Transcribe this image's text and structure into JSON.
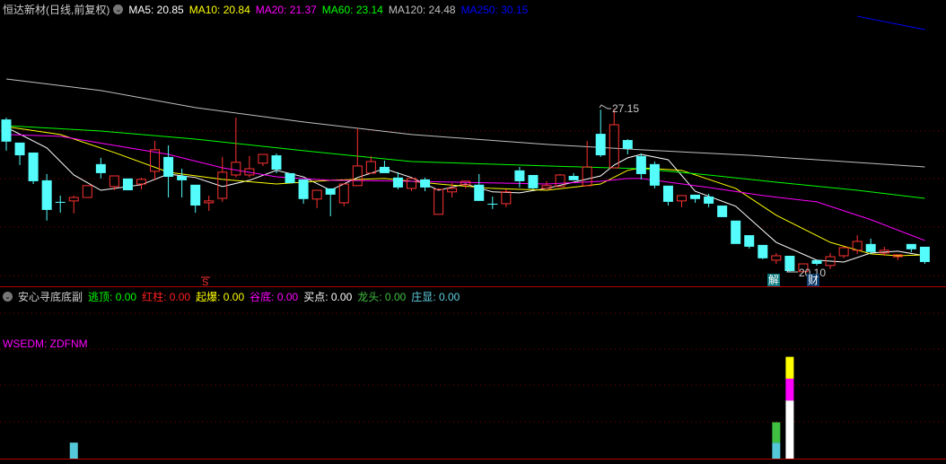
{
  "header": {
    "title": "恒达新材(日线,前复权)",
    "ma": [
      {
        "label": "MA5: 20.85",
        "color": "#ffffff"
      },
      {
        "label": "MA10: 20.84",
        "color": "#ffff00"
      },
      {
        "label": "MA20: 21.37",
        "color": "#ff00ff"
      },
      {
        "label": "MA60: 23.14",
        "color": "#00ff00"
      },
      {
        "label": "MA120: 24.48",
        "color": "#c0c0c0"
      },
      {
        "label": "MA250: 30.15",
        "color": "#0000ff"
      }
    ]
  },
  "indicator": {
    "title": "安心寻底底副",
    "items": [
      {
        "name": "逃顶",
        "value": "0.00",
        "color": "#00ff00"
      },
      {
        "name": "红柱",
        "value": "0.00",
        "color": "#ff2020"
      },
      {
        "name": "起爆",
        "value": "0.00",
        "color": "#ffff00"
      },
      {
        "name": "谷底",
        "value": "0.00",
        "color": "#ff00ff"
      },
      {
        "name": "买点",
        "value": "0.00",
        "color": "#ffffff"
      },
      {
        "name": "龙头",
        "value": "0.00",
        "color": "#40c040"
      },
      {
        "name": "庄显",
        "value": "0.00",
        "color": "#60d0e0"
      }
    ],
    "formula_label": "WSEDM: ZDFNM"
  },
  "markers": {
    "high_label": "27.15",
    "low_label": "20.10",
    "badge_jie": "解",
    "badge_cai": "财",
    "signal_s": "S"
  },
  "colors": {
    "up": "#ff3232",
    "down": "#54fcfc",
    "grid": "#800000"
  },
  "chart_data": {
    "type": "candlestick",
    "ylim": [
      19.51,
      31.84
    ],
    "candles": [
      [
        26.68,
        25.72,
        26.76,
        25.33
      ],
      [
        25.68,
        25.13,
        25.68,
        24.71
      ],
      [
        25.25,
        24.01,
        25.25,
        23.89
      ],
      [
        24.05,
        22.77,
        24.32,
        22.31
      ],
      [
        23.12,
        23.12,
        23.39,
        22.65
      ],
      [
        23.16,
        23.31,
        23.39,
        22.62
      ],
      [
        23.31,
        23.82,
        23.82,
        23.31
      ],
      [
        24.75,
        24.36,
        25.02,
        24.13
      ],
      [
        23.78,
        24.24,
        24.24,
        23.62
      ],
      [
        24.13,
        23.62,
        24.13,
        23.62
      ],
      [
        23.89,
        24.09,
        24.17,
        23.66
      ],
      [
        24.44,
        25.37,
        25.75,
        24.05
      ],
      [
        25.06,
        24.2,
        25.56,
        23.31
      ],
      [
        24.24,
        24.05,
        24.55,
        23.31
      ],
      [
        23.86,
        22.96,
        23.86,
        22.65
      ],
      [
        23.08,
        23.16,
        23.39,
        22.73
      ],
      [
        23.27,
        24.4,
        25.06,
        23.12
      ],
      [
        24.28,
        24.83,
        26.76,
        24.17
      ],
      [
        24.28,
        24.55,
        25.1,
        24.17
      ],
      [
        24.79,
        25.17,
        25.17,
        24.67
      ],
      [
        25.13,
        24.51,
        25.21,
        24.36
      ],
      [
        24.36,
        23.93,
        24.36,
        23.93
      ],
      [
        24.09,
        23.24,
        24.09,
        23.04
      ],
      [
        23.24,
        23.62,
        23.62,
        22.85
      ],
      [
        23.7,
        23.43,
        23.7,
        22.5
      ],
      [
        23.08,
        23.89,
        23.89,
        22.93
      ],
      [
        23.82,
        24.67,
        26.3,
        23.82
      ],
      [
        24.36,
        24.86,
        25.1,
        24.36
      ],
      [
        24.63,
        24.36,
        24.9,
        24.36
      ],
      [
        24.17,
        23.74,
        24.4,
        23.66
      ],
      [
        23.7,
        24.13,
        24.13,
        23.58
      ],
      [
        24.09,
        23.74,
        24.17,
        23.58
      ],
      [
        22.58,
        23.66,
        23.7,
        22.58
      ],
      [
        23.55,
        23.7,
        23.93,
        23.31
      ],
      [
        23.86,
        24.01,
        24.01,
        23.7
      ],
      [
        23.86,
        23.16,
        24.32,
        23.16
      ],
      [
        23.04,
        23.04,
        23.35,
        22.81
      ],
      [
        23.04,
        23.55,
        23.66,
        22.89
      ],
      [
        24.48,
        24.01,
        24.63,
        23.74
      ],
      [
        24.28,
        23.7,
        24.28,
        23.66
      ],
      [
        23.7,
        23.82,
        24.01,
        23.7
      ],
      [
        23.78,
        24.28,
        24.32,
        23.78
      ],
      [
        24.24,
        24.05,
        24.36,
        24.05
      ],
      [
        23.82,
        24.63,
        25.75,
        23.82
      ],
      [
        26.06,
        25.13,
        27.1,
        25.06
      ],
      [
        24.59,
        26.45,
        27.15,
        24.59
      ],
      [
        25.79,
        25.41,
        25.83,
        25.17
      ],
      [
        25.1,
        24.32,
        25.21,
        24.09
      ],
      [
        24.75,
        23.82,
        24.86,
        23.7
      ],
      [
        23.82,
        23.12,
        23.82,
        22.96
      ],
      [
        23.16,
        23.39,
        23.39,
        22.89
      ],
      [
        23.43,
        23.24,
        23.43,
        23.08
      ],
      [
        23.35,
        23.04,
        23.47,
        22.89
      ],
      [
        22.96,
        22.46,
        22.96,
        22.46
      ],
      [
        22.31,
        21.3,
        22.31,
        21.3
      ],
      [
        21.68,
        21.18,
        21.68,
        21.1
      ],
      [
        21.26,
        20.68,
        21.26,
        20.64
      ],
      [
        20.6,
        20.79,
        20.91,
        20.44
      ],
      [
        20.79,
        20.13,
        20.79,
        20.1
      ],
      [
        20.1,
        20.44,
        20.44,
        20.1
      ],
      [
        20.6,
        20.44,
        20.6,
        20.37
      ],
      [
        20.37,
        20.75,
        20.91,
        20.21
      ],
      [
        20.79,
        21.14,
        21.18,
        20.68
      ],
      [
        21.03,
        21.41,
        21.68,
        20.87
      ],
      [
        21.3,
        20.95,
        21.53,
        20.87
      ],
      [
        20.91,
        21.03,
        21.18,
        20.79
      ],
      [
        20.75,
        20.83,
        20.83,
        20.6
      ],
      [
        21.3,
        21.07,
        21.3,
        20.95
      ],
      [
        21.18,
        20.52,
        21.18,
        20.44
      ]
    ],
    "candle_format": [
      "open",
      "close",
      "high",
      "low"
    ],
    "series": [
      {
        "name": "MA5",
        "color": "#ffffff",
        "points": [
          [
            0,
            26.34
          ],
          [
            3,
            25.45
          ],
          [
            5,
            24.28
          ],
          [
            7,
            23.62
          ],
          [
            10,
            23.86
          ],
          [
            12,
            24.32
          ],
          [
            14,
            24.17
          ],
          [
            16,
            23.78
          ],
          [
            18,
            24.05
          ],
          [
            20,
            24.48
          ],
          [
            22,
            24.2
          ],
          [
            24,
            23.62
          ],
          [
            26,
            24.17
          ],
          [
            28,
            24.55
          ],
          [
            30,
            24.17
          ],
          [
            32,
            23.62
          ],
          [
            34,
            23.89
          ],
          [
            36,
            23.55
          ],
          [
            38,
            23.51
          ],
          [
            40,
            23.7
          ],
          [
            42,
            23.97
          ],
          [
            44,
            24.24
          ],
          [
            45,
            24.71
          ],
          [
            46,
            25.02
          ],
          [
            47,
            25.17
          ],
          [
            49,
            24.94
          ],
          [
            51,
            23.58
          ],
          [
            54,
            22.93
          ],
          [
            57,
            21.37
          ],
          [
            60,
            20.6
          ],
          [
            62,
            20.52
          ],
          [
            64,
            20.91
          ],
          [
            66,
            20.99
          ],
          [
            68,
            20.79
          ]
        ]
      },
      {
        "name": "MA10",
        "color": "#ffff00",
        "points": [
          [
            0,
            26.37
          ],
          [
            4,
            26.03
          ],
          [
            8,
            25.25
          ],
          [
            12,
            24.4
          ],
          [
            16,
            24.09
          ],
          [
            20,
            23.89
          ],
          [
            24,
            24.05
          ],
          [
            28,
            24.13
          ],
          [
            32,
            23.89
          ],
          [
            36,
            23.7
          ],
          [
            40,
            23.62
          ],
          [
            44,
            23.89
          ],
          [
            46,
            24.48
          ],
          [
            47,
            24.59
          ],
          [
            50,
            24.48
          ],
          [
            54,
            23.7
          ],
          [
            57,
            22.54
          ],
          [
            61,
            21.37
          ],
          [
            64,
            20.87
          ],
          [
            66,
            20.79
          ],
          [
            68,
            20.83
          ]
        ]
      },
      {
        "name": "MA20",
        "color": "#ff00ff",
        "points": [
          [
            0,
            26.03
          ],
          [
            4,
            25.95
          ],
          [
            8,
            25.56
          ],
          [
            12,
            25.17
          ],
          [
            16,
            24.59
          ],
          [
            20,
            24.2
          ],
          [
            24,
            24.05
          ],
          [
            30,
            24.01
          ],
          [
            40,
            23.89
          ],
          [
            44,
            24.01
          ],
          [
            46,
            24.13
          ],
          [
            47,
            24.13
          ],
          [
            52,
            23.74
          ],
          [
            56,
            23.39
          ],
          [
            60,
            23.12
          ],
          [
            64,
            22.35
          ],
          [
            68,
            21.45
          ]
        ]
      },
      {
        "name": "MA60",
        "color": "#00ff00",
        "points": [
          [
            0,
            26.41
          ],
          [
            7,
            26.18
          ],
          [
            14,
            25.83
          ],
          [
            22,
            25.33
          ],
          [
            30,
            24.86
          ],
          [
            40,
            24.67
          ],
          [
            47,
            24.55
          ],
          [
            52,
            24.28
          ],
          [
            57,
            23.97
          ],
          [
            63,
            23.62
          ],
          [
            68,
            23.27
          ]
        ]
      },
      {
        "name": "MA120",
        "color": "#c0c0c0",
        "points": [
          [
            0,
            28.43
          ],
          [
            7,
            27.93
          ],
          [
            14,
            27.19
          ],
          [
            22,
            26.57
          ],
          [
            30,
            26.03
          ],
          [
            40,
            25.6
          ],
          [
            47,
            25.37
          ],
          [
            55,
            25.13
          ],
          [
            62,
            24.86
          ],
          [
            68,
            24.63
          ]
        ]
      },
      {
        "name": "MA250",
        "color": "#0000ff",
        "points": [
          [
            63,
            31.14
          ],
          [
            68,
            30.56
          ]
        ]
      }
    ],
    "indicator_bars": {
      "ylim": [
        0,
        5
      ],
      "bars": [
        {
          "index": 5,
          "segments": [
            {
              "color": "#54c8d8",
              "value": 0.55
            }
          ]
        },
        {
          "index": 57,
          "segments": [
            {
              "color": "#54c8d8",
              "value": 0.55
            },
            {
              "color": "#40c040",
              "value": 0.7
            }
          ]
        },
        {
          "index": 58,
          "segments": [
            {
              "color": "#ffffff",
              "value": 2.0
            },
            {
              "color": "#ff00ff",
              "value": 0.75
            },
            {
              "color": "#ffff00",
              "value": 0.75
            }
          ]
        }
      ]
    }
  }
}
